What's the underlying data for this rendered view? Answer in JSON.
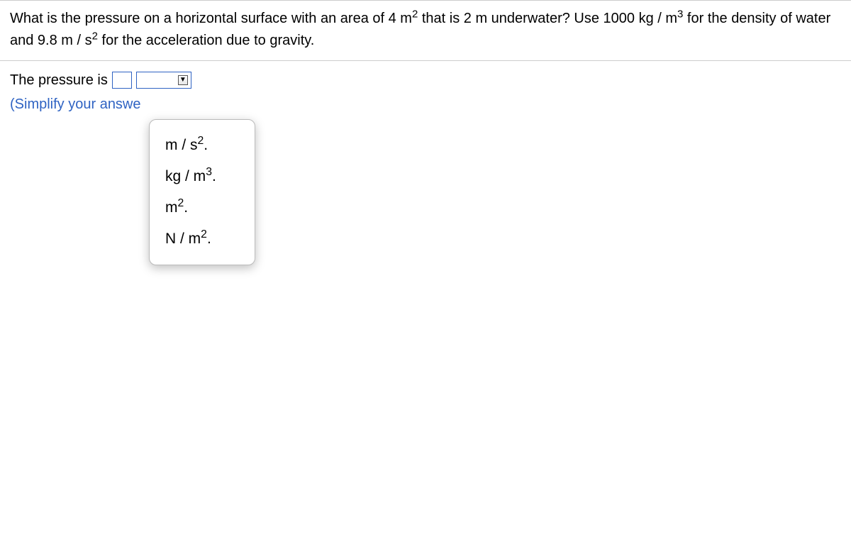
{
  "question": {
    "p1a": "What is the pressure on a horizontal surface with an area of 4 m",
    "p1a_sup": "2",
    "p1b": " that is 2 m underwater? Use 1000 kg / m",
    "p1b_sup": "3",
    "p1c": " for the density of water and 9.8 m / s",
    "p1c_sup": "2",
    "p1d": " for the acceleration due to gravity."
  },
  "answer": {
    "label": "The pressure is",
    "hint": "(Simplify your answe"
  },
  "dropdown": {
    "options": [
      {
        "base": "m / s",
        "sup": "2",
        "tail": "."
      },
      {
        "base": "kg / m",
        "sup": "3",
        "tail": "."
      },
      {
        "base": "m",
        "sup": "2",
        "tail": "."
      },
      {
        "base": "N / m",
        "sup": "2",
        "tail": "."
      }
    ]
  }
}
